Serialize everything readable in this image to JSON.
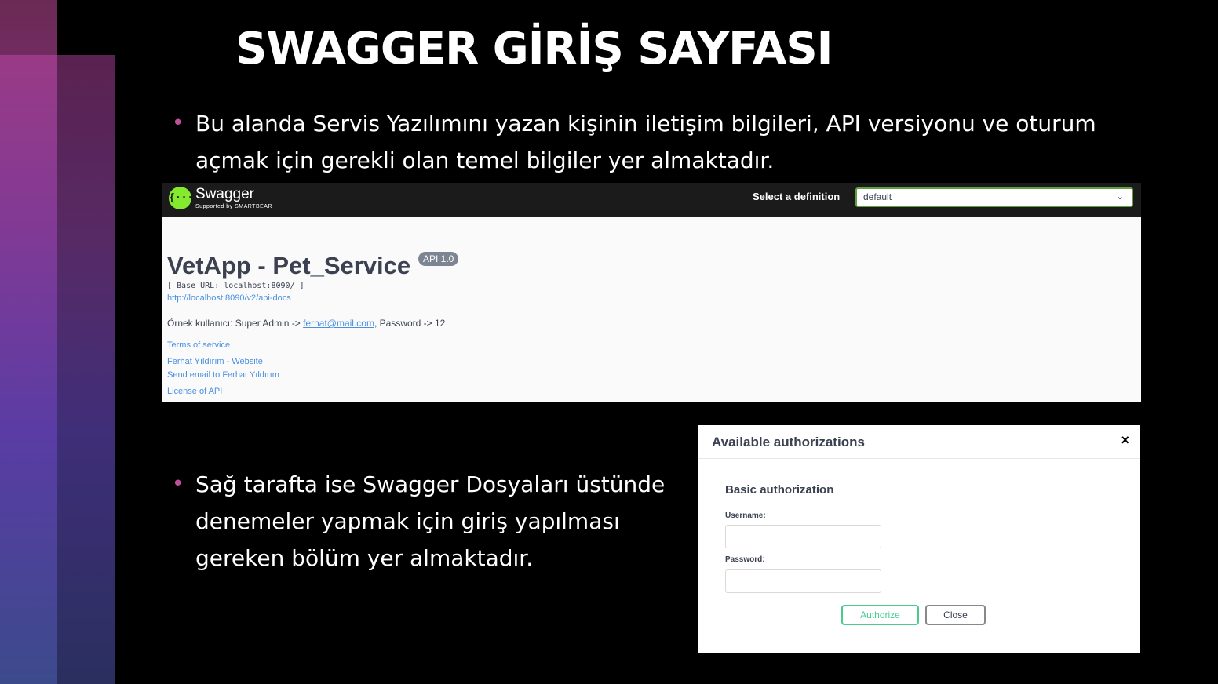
{
  "title": "SWAGGER GİRİŞ SAYFASI",
  "bullets": [
    "Bu alanda Servis Yazılımını yazan kişinin iletişim bilgileri, API versiyonu ve oturum açmak için gerekli olan temel bilgiler yer almaktadır.",
    "Sağ tarafta ise Swagger Dosyaları üstünde denemeler yapmak için giriş yapılması gereken bölüm yer almaktadır."
  ],
  "bullet_symbol": "•",
  "swagger": {
    "logo_glyph": "{···}",
    "brand": "Swagger",
    "brand_sub": "Supported by SMARTBEAR",
    "definition_label": "Select a definition",
    "definition_value": "default",
    "chevron": "⌄",
    "api_title": "VetApp - Pet_Service",
    "api_version": "API 1.0",
    "base_url": "[ Base URL: localhost:8090/ ]",
    "docs_link": "http://localhost:8090/v2/api-docs",
    "description_prefix": "Örnek kullanıcı: Super Admin -> ",
    "description_email": "ferhat@mail.com",
    "description_suffix": ", Password -> 12",
    "links": {
      "terms": "Terms of service",
      "website": "Ferhat Yıldırım - Website",
      "email": "Send email to Ferhat Yıldırım",
      "license": "License of API"
    }
  },
  "auth": {
    "title": "Available authorizations",
    "close_glyph": "×",
    "section": "Basic authorization",
    "username_label": "Username:",
    "password_label": "Password:",
    "authorize_label": "Authorize",
    "close_label": "Close"
  },
  "colors": {
    "bullet_dot": "#c0509a",
    "swagger_green": "#85ea2d",
    "authorize_green": "#49cc90",
    "link_blue": "#4990e2"
  }
}
